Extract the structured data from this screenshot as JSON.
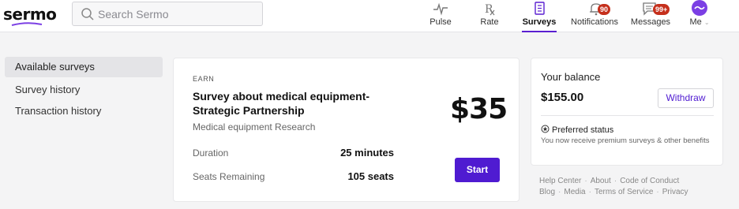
{
  "header": {
    "logo_text": "sermo",
    "search_placeholder": "Search Sermo",
    "nav": [
      {
        "label": "Pulse",
        "icon": "pulse-icon"
      },
      {
        "label": "Rate",
        "icon": "rx-icon"
      },
      {
        "label": "Surveys",
        "icon": "surveys-icon",
        "active": true
      },
      {
        "label": "Notifications",
        "icon": "bell-icon",
        "badge": "90"
      },
      {
        "label": "Messages",
        "icon": "messages-icon",
        "badge": "99+"
      },
      {
        "label": "Me",
        "icon": "avatar"
      }
    ]
  },
  "sidebar": {
    "items": [
      {
        "label": "Available surveys",
        "active": true
      },
      {
        "label": "Survey history"
      },
      {
        "label": "Transaction history"
      }
    ]
  },
  "survey": {
    "tag": "EARN",
    "title": "Survey about medical equipment- Strategic Partnership",
    "subtitle": "Medical equipment Research",
    "price": "$35",
    "duration_label": "Duration",
    "duration_value": "25 minutes",
    "seats_label": "Seats Remaining",
    "seats_value": "105 seats",
    "start_label": "Start"
  },
  "balance": {
    "title": "Your balance",
    "amount": "$155.00",
    "withdraw_label": "Withdraw",
    "preferred_title": "Preferred status",
    "preferred_desc": "You now receive premium surveys & other benefits"
  },
  "footer": {
    "row1": [
      "Help Center",
      "About",
      "Code of Conduct"
    ],
    "row2": [
      "Blog",
      "Media",
      "Terms of Service",
      "Privacy"
    ]
  },
  "colors": {
    "accent": "#4f1bd1",
    "badge": "#c5301c",
    "background": "#f4f4f5"
  }
}
